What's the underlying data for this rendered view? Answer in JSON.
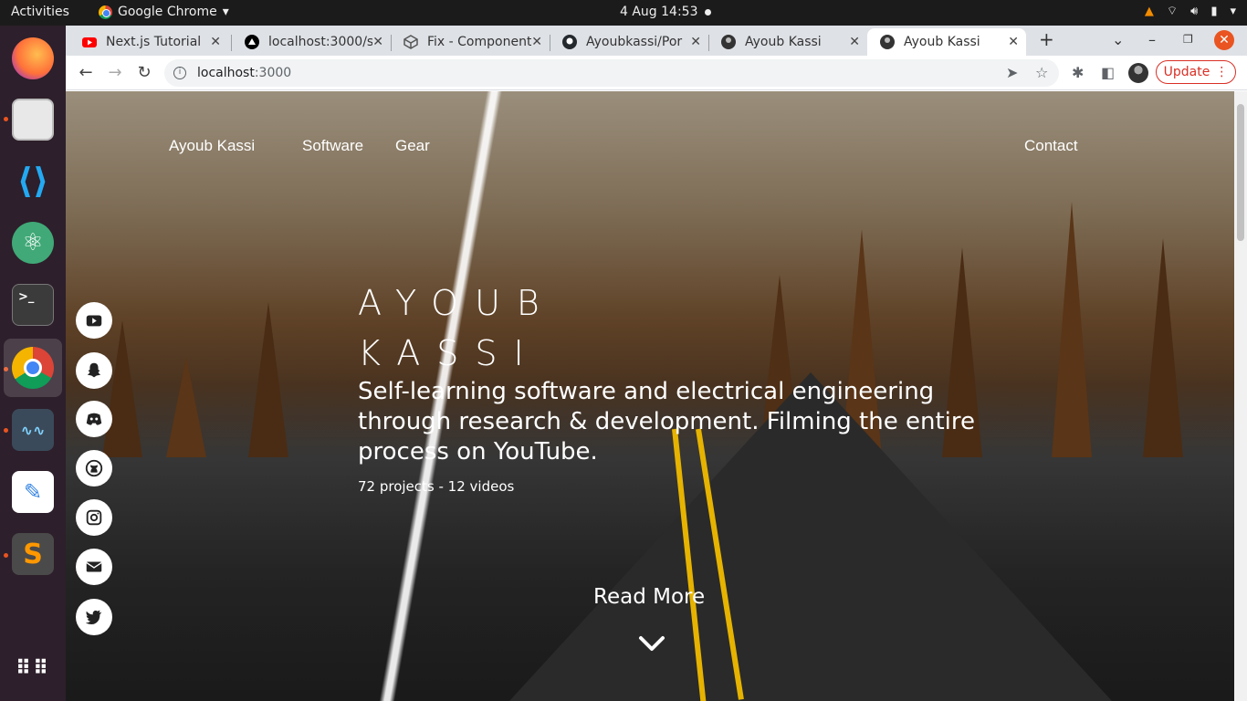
{
  "topbar": {
    "activities": "Activities",
    "app_name": "Google Chrome",
    "clock": "4 Aug  14:53"
  },
  "dock": {
    "apps": [
      "firefox-icon",
      "files-icon",
      "vscode-icon",
      "atom-icon",
      "terminal-icon",
      "chrome-icon",
      "system-monitor-icon",
      "text-editor-icon",
      "sublime-icon",
      "app-grid-icon"
    ]
  },
  "browser": {
    "tabs": [
      {
        "title": "Next.js Tutorial",
        "icon": "youtube-icon"
      },
      {
        "title": "localhost:3000/s",
        "icon": "vercel-icon"
      },
      {
        "title": "Fix - Component",
        "icon": "cube-icon"
      },
      {
        "title": "Ayoubkassi/Por",
        "icon": "github-icon"
      },
      {
        "title": "Ayoub Kassi",
        "icon": "avatar-icon"
      },
      {
        "title": "Ayoub Kassi",
        "icon": "avatar-icon",
        "active": true
      }
    ],
    "url_host": "localhost",
    "url_port": ":3000",
    "update_label": "Update"
  },
  "site": {
    "nav": {
      "brand": "Ayoub Kassi",
      "links": [
        "Software",
        "Gear"
      ],
      "contact": "Contact"
    },
    "hero": {
      "name_line1": "AYOUB",
      "name_line2": "KASSI",
      "tagline": "Self-learning software and electrical engineering through research & development. Filming the entire process on YouTube.",
      "stats": "72 projects - 12 videos",
      "read_more": "Read More"
    },
    "social": [
      "youtube-icon",
      "snapchat-icon",
      "discord-icon",
      "github-icon",
      "instagram-icon",
      "mail-icon",
      "twitter-icon"
    ]
  },
  "colors": {
    "update_red": "#d93025",
    "ubuntu_orange": "#e95420",
    "road_yellow": "#e6b300"
  }
}
